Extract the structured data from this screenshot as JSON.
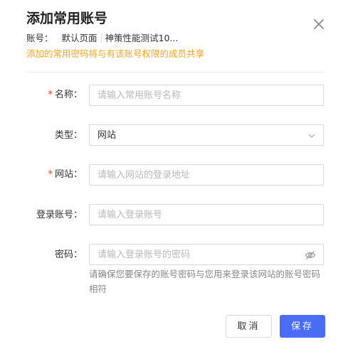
{
  "dialog": {
    "title": "添加常用账号",
    "account_label": "账号：",
    "account_page": "默认页面",
    "account_name": "神策性能测试10...",
    "notice": "添加的常用密码将与有该账号权限的成员共享"
  },
  "form": {
    "name": {
      "required": "*",
      "label": "名称：",
      "placeholder": "请输入常用账号名称"
    },
    "type": {
      "label": "类型：",
      "value": "网站"
    },
    "site": {
      "required": "*",
      "label": "网站：",
      "placeholder": "请输入网站的登录地址"
    },
    "login": {
      "label": "登录账号：",
      "placeholder": "请输入登录账号"
    },
    "password": {
      "label": "密码：",
      "placeholder": "请输入登录账号的密码",
      "hint": "请确保您要保存的账号密码与您用来登录该网站的账号密码相符"
    }
  },
  "buttons": {
    "cancel": "取消",
    "save": "保存"
  },
  "colors": {
    "primary": "#4a6cf7",
    "notice": "#f5a623",
    "required": "#e53935"
  },
  "icons": {
    "close": "close-icon",
    "chevron": "chevron-down-icon",
    "eye": "eye-off-icon"
  }
}
